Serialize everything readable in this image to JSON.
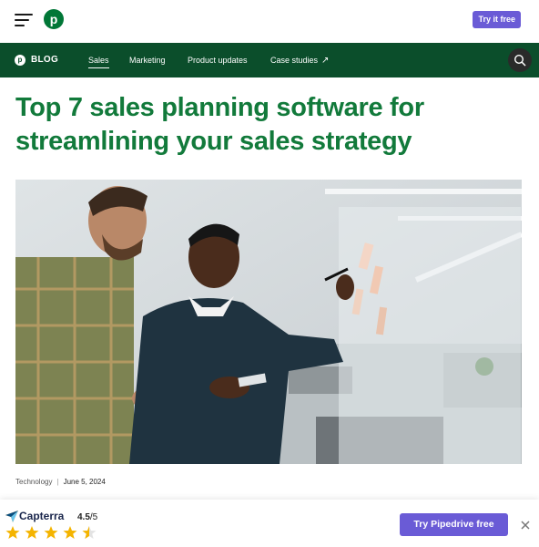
{
  "header": {
    "try_free_label": "Try it free"
  },
  "nav": {
    "blog_label": "BLOG",
    "items": [
      {
        "label": "Sales",
        "active": true
      },
      {
        "label": "Marketing"
      },
      {
        "label": "Product updates"
      },
      {
        "label": "Case studies"
      }
    ],
    "search_icon": "search-icon"
  },
  "article": {
    "title": "Top 7 sales planning software for streamlining your sales strategy",
    "category": "Technology",
    "date": "June 5, 2024"
  },
  "footer_bar": {
    "capterra_name": "Capterra",
    "rating_value": "4.5",
    "rating_scale": "/5",
    "stars": 4.5,
    "cta_label": "Try Pipedrive free"
  },
  "colors": {
    "brand_green": "#127a3b",
    "nav_green": "#0b4e2b",
    "cta_purple": "#6a5bd6",
    "star_yellow": "#f4b400"
  }
}
